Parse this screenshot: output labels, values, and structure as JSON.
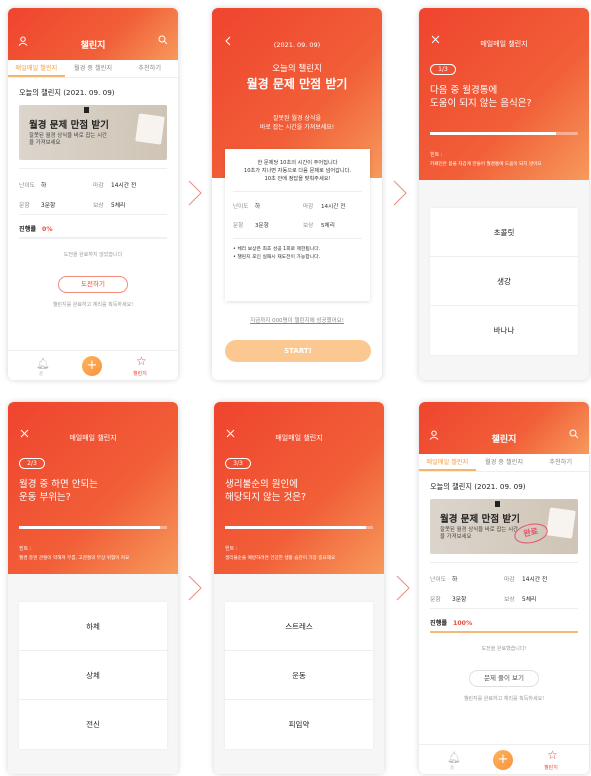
{
  "colors": {
    "accent": "#f0442e",
    "accent_light": "#f79a5c",
    "highlight": "#f39b3b"
  },
  "home": {
    "title": "챌린지",
    "tabs": [
      "매일매일 챌린지",
      "월경 중 챌린지",
      "추천하기"
    ],
    "date_label": "오늘의 챌린지 (2021. 09. 09)",
    "banner_title": "월경 문제 만점 받기",
    "banner_sub": "잘못된 월경 상식을 바로 잡는 시간을 가져보세요",
    "difficulty_label": "난이도",
    "difficulty": "하",
    "deadline_label": "마감",
    "deadline": "14시간 전",
    "questions_label": "문항",
    "questions": "3문항",
    "reward_label": "보상",
    "reward": "5체리",
    "progress_label": "진행률",
    "progress_before": "0%",
    "progress_after": "100%",
    "progress_before_value": 0,
    "progress_after_value": 100,
    "note_before": "도전을 완료하지 않았습니다",
    "note_after": "도전을 완료했습니다!",
    "cta_before": "도전하기",
    "cta_after": "문제 풀이 보기",
    "footer_note": "챌린지를 완료하고 체리를 획득하세요!",
    "done_stamp": "완료",
    "nav_bell": "홈",
    "nav_star": "챌린지"
  },
  "detail": {
    "date": "(2021. 09. 09)",
    "subtitle": "오늘의 챌린지",
    "title": "월경 문제 만점 받기",
    "desc_1": "잘못된 월경 상식을",
    "desc_2": "바로 잡는 시간을 가져보세요!",
    "rule_1": "한 문제당 10초의 시간이 주어집니다",
    "rule_2": "10초가 지나면 자동으로 다음 문제로 넘어갑니다.",
    "rule_3": "10초 안에 정답을 맞춰주세요!",
    "difficulty_label": "난이도",
    "difficulty": "하",
    "deadline_label": "마감",
    "deadline": "14시간 전",
    "questions_label": "문항",
    "questions": "3문항",
    "reward_label": "보상",
    "reward": "5체리",
    "bullet_1": "• 체리 보상은 최초 성공 1회로 제한됩니다.",
    "bullet_2": "• 챌린지 포인 실패시 재도전이 가능합니다.",
    "link": "지금까지 000명이 챌린지에 성공했어요!",
    "start": "START!"
  },
  "quiz_title": "매일매일 챌린지",
  "hint_label": "힌트 :",
  "quiz": [
    {
      "step": "1/3",
      "q1": "다음 중 월경통에",
      "q2": "도움이 되지 않는 음식은?",
      "progress": 0.85,
      "hint": "카페인은 몸을 차갑게 만들어 월경통에 도움이 되지 않아요",
      "options": [
        "초콜릿",
        "생강",
        "바나나"
      ]
    },
    {
      "step": "2/3",
      "q1": "월경 중 하면 안되는",
      "q2": "운동 부위는?",
      "progress": 0.95,
      "hint": "월경 중엔 관절이 약해져 무릎, 고관절의 부상 위험이 커요",
      "options": [
        "하체",
        "상체",
        "전신"
      ]
    },
    {
      "step": "3/3",
      "q1": "생리불순의 원인에",
      "q2": "해당되지 않는 것은?",
      "progress": 0.95,
      "hint": "생리불순을 예방하려면 건강한 생활 습관이 가장 중요해요",
      "options": [
        "스트레스",
        "운동",
        "피임약"
      ]
    }
  ]
}
